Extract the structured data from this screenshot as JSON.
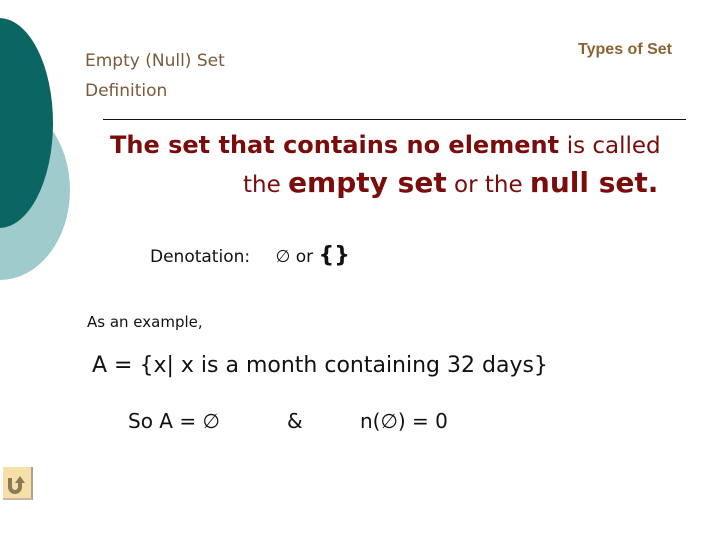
{
  "header": {
    "subtitle_line1": "Empty (Null) Set",
    "subtitle_line2": "Definition",
    "section_title": "Types of Set"
  },
  "definition": {
    "line1_bold": "The set that contains no element",
    "line1_normal": "is called",
    "line2_part1": "the",
    "line2_term1": "empty set",
    "line2_part2": "or the",
    "line2_term2": "null set",
    "line2_end": "."
  },
  "denotation": {
    "label": "Denotation:",
    "symbol1": "∅",
    "or": "or",
    "symbol2": "{}"
  },
  "example": {
    "intro": "As an example,",
    "set_definition": "A = {x| x is a month containing 32 days}",
    "conclusion": "So A = ∅",
    "ampersand": "&",
    "cardinality": "n(∅) = 0"
  },
  "navigation": {
    "back_icon": "return-arrow-icon",
    "accent_color": "#f4e0a8"
  },
  "colors": {
    "dark_teal": "#0b6663",
    "light_teal": "#9fcbcc",
    "heading_brown": "#7a5a3a",
    "definition_red": "#7a0c0c"
  }
}
